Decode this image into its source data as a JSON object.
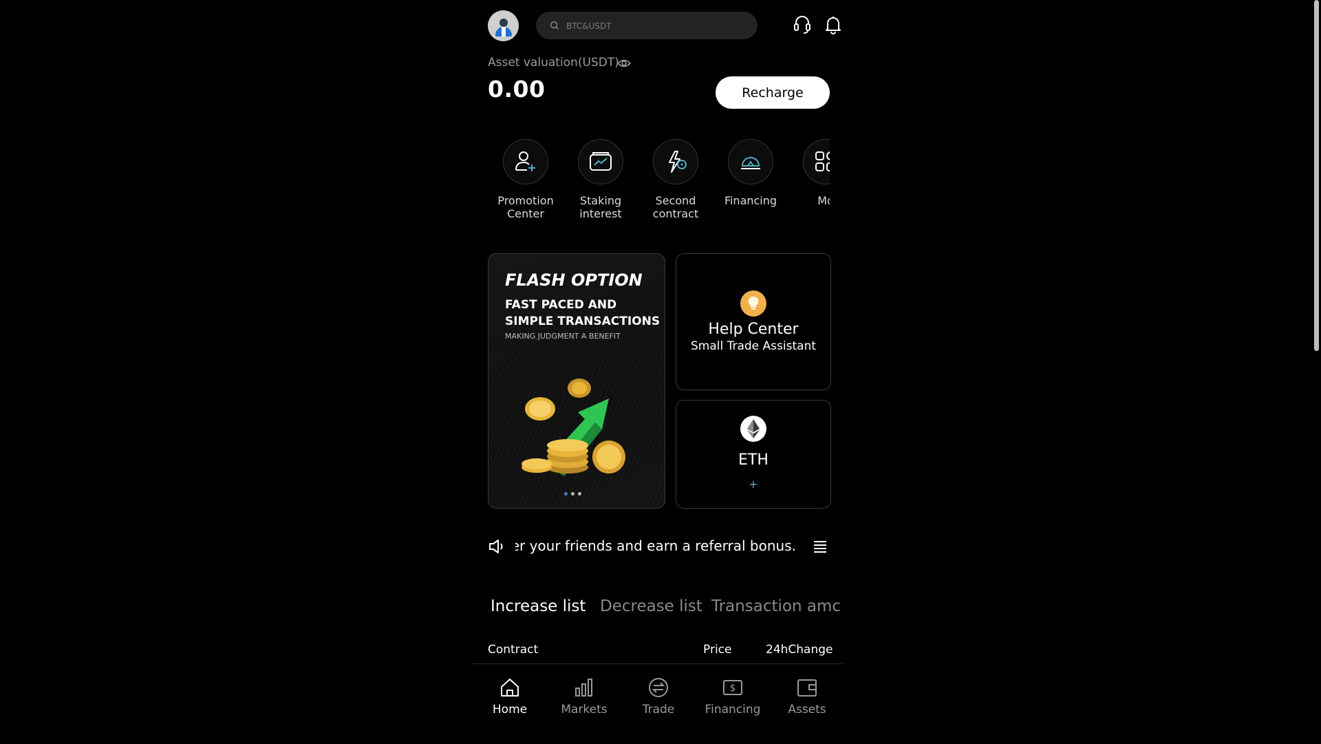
{
  "search": {
    "placeholder": "BTC&USDT"
  },
  "asset": {
    "label": "Asset valuation(USDT)",
    "value": "0.00",
    "recharge_label": "Recharge"
  },
  "quick_menu": [
    {
      "label": "Promotion Center",
      "icon": "user-plus-icon"
    },
    {
      "label": "Staking interest",
      "icon": "wallet-chart-icon"
    },
    {
      "label": "Second contract",
      "icon": "lightning-clock-icon"
    },
    {
      "label": "Financing",
      "icon": "piggy-dome-icon"
    },
    {
      "label": "Mo",
      "icon": "more-grid-icon"
    }
  ],
  "banner": {
    "title": "FLASH OPTION",
    "subtitle": "FAST PACED AND SIMPLE TRANSACTIONS",
    "note": "MAKING JUDGMENT A BENEFIT",
    "active_dot": 0,
    "dot_count": 3
  },
  "help_card": {
    "title": "Help Center",
    "subtitle": "Small Trade Assistant"
  },
  "eth_card": {
    "name": "ETH",
    "plus": "+"
  },
  "notice": {
    "text": "efer your friends and earn a referral bonus."
  },
  "tabs": [
    {
      "label": "Increase list",
      "active": true
    },
    {
      "label": "Decrease list",
      "active": false
    },
    {
      "label": "Transaction amc",
      "active": false
    }
  ],
  "table_header": {
    "contract": "Contract",
    "price": "Price",
    "change": "24hChange"
  },
  "bottom_nav": [
    {
      "label": "Home",
      "icon": "home-icon",
      "active": true
    },
    {
      "label": "Markets",
      "icon": "bar-chart-icon",
      "active": false
    },
    {
      "label": "Trade",
      "icon": "exchange-icon",
      "active": false
    },
    {
      "label": "Financing",
      "icon": "dollar-card-icon",
      "active": false
    },
    {
      "label": "Assets",
      "icon": "wallet-icon",
      "active": false
    }
  ],
  "colors": {
    "background": "#000000",
    "accent_blue": "#3a86d1",
    "bulb_orange": "#f0b14b",
    "green_arrow": "#2fc552",
    "gold": "#e8b53a"
  }
}
